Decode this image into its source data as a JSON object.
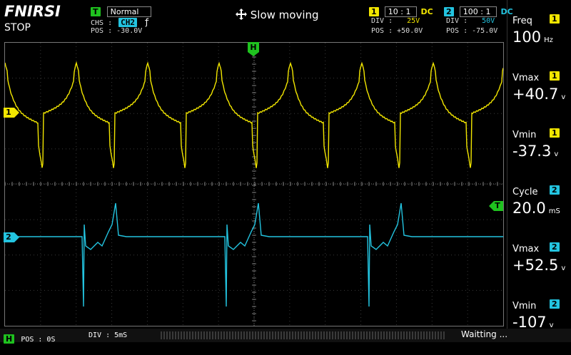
{
  "header": {
    "brand": "FNIRSI",
    "run_state": "STOP",
    "trigger_badge": "T",
    "trigger_mode": "Normal",
    "chs_label": "CHS :",
    "chs_value": "CH2",
    "edge_glyph": "ƒ",
    "pos_label": "POS :",
    "pos_value": "-30.0V",
    "center_title": "Slow moving",
    "move_icon": "move-arrows-icon"
  },
  "ch1": {
    "num": "1",
    "probe": "10 : 1",
    "coupling": "DC",
    "div_label": "DIV :",
    "div_value": "25V",
    "pos_label": "POS :",
    "pos_value": "+50.0V",
    "color": "#f2e600"
  },
  "ch2": {
    "num": "2",
    "probe": "100 : 1",
    "coupling": "DC",
    "div_label": "DIV :",
    "div_value": "50V",
    "pos_label": "POS :",
    "pos_value": "-75.0V",
    "color": "#23c4e0"
  },
  "measurements": [
    {
      "label": "Freq",
      "ch": "1",
      "value": "100",
      "unit": "Hz"
    },
    {
      "label": "Vmax",
      "ch": "1",
      "value": "+40.7",
      "unit": "v"
    },
    {
      "label": "Vmin",
      "ch": "1",
      "value": "-37.3",
      "unit": "v"
    },
    {
      "label": "Cycle",
      "ch": "2",
      "value": "20.0",
      "unit": "mS"
    },
    {
      "label": "Vmax",
      "ch": "2",
      "value": "+52.5",
      "unit": "v"
    },
    {
      "label": "Vmin",
      "ch": "2",
      "value": "-107",
      "unit": "v"
    }
  ],
  "markers": {
    "h": "H",
    "t": "T",
    "ch1": "1",
    "ch2": "2"
  },
  "footer": {
    "h_badge": "H",
    "pos_label": "POS : 0S",
    "div_label": "DIV : 5mS",
    "status": "Waitting ..."
  },
  "colors": {
    "green": "#1fc21f",
    "yellow": "#f2e600",
    "cyan": "#23c4e0"
  }
}
